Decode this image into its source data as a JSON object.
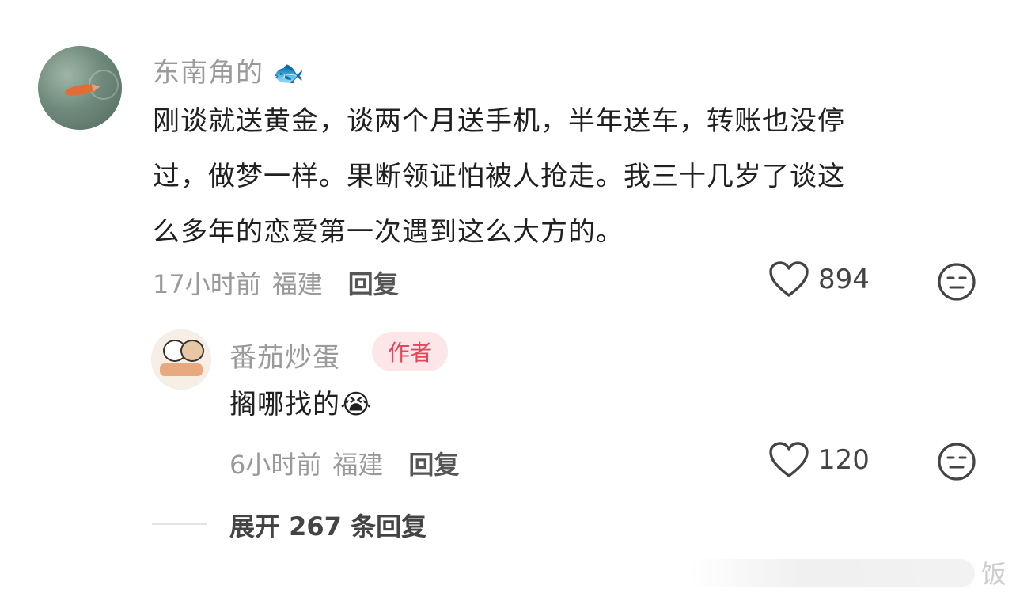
{
  "comment": {
    "username": "东南角的",
    "username_emoji": "🐟",
    "text_lines": [
      "刚谈就送黄金，谈两个月送手机，半年送车，转账也没停",
      "过，做梦一样。果断领证怕被人抢走。我三十几岁了谈这",
      "么多年的恋爱第一次遇到这么大方的。"
    ],
    "time": "17小时前",
    "location": "福建",
    "reply_label": "回复",
    "likes": "894"
  },
  "reply": {
    "username": "番茄炒蛋",
    "badge": "作者",
    "text": "搁哪找的",
    "emoji": "😭",
    "time": "6小时前",
    "location": "福建",
    "reply_label": "回复",
    "likes": "120"
  },
  "expand": {
    "label": "展开 267 条回复"
  },
  "watermark": {
    "text": "饭"
  },
  "icons": {
    "like": "heart-outline-icon",
    "dislike": "neutral-face-icon"
  }
}
